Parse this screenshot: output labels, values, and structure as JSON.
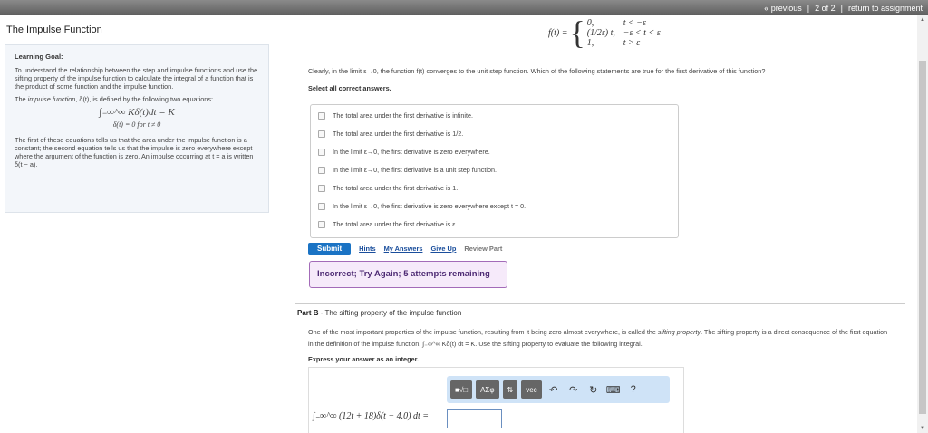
{
  "topbar": {
    "previous": "« previous",
    "position": "2 of 2",
    "return": "return to assignment"
  },
  "left": {
    "title": "The Impulse Function",
    "goal_heading": "Learning Goal:",
    "goal_text": "To understand the relationship between the step and impulse functions and use the sifting property of the impulse function to calculate the integral of a function that is the product of some function and the impulse function.",
    "def_pre": "The ",
    "def_em": "impulse function",
    "def_post": ", δ(t), is defined by the following two equations:",
    "eq1": "∫₋∞^∞ Kδ(t)dt = K",
    "eq2": "δ(t) = 0 for t ≠ 0",
    "explain": "The first of these equations tells us that the area under the impulse function is a constant; the second equation tells us that the impulse is zero everywhere except where the argument of the function is zero. An impulse occurring at t = a is written δ(t − a)."
  },
  "piecewise": {
    "lhs": "f(t) =",
    "rows": [
      [
        "0,",
        "t < −ε"
      ],
      [
        "(1/2ε) t,",
        "−ε < t < ε"
      ],
      [
        "1,",
        "t > ε"
      ]
    ]
  },
  "partA": {
    "question": "Clearly, in the limit ε→0, the function f(t) converges to the unit step function. Which of the following statements are true for the first derivative of this function?",
    "instruction": "Select all correct answers.",
    "options": [
      "The total area under the first derivative is infinite.",
      "The total area under the first derivative is 1/2.",
      "In the limit ε→0, the first derivative is zero everywhere.",
      "In the limit ε→0, the first derivative is a unit step function.",
      "The total area under the first derivative is 1.",
      "In the limit ε→0, the first derivative is zero everywhere except t = 0.",
      "The total area under the first derivative is ε."
    ],
    "submit": "Submit",
    "hints": "Hints",
    "my_answers": "My Answers",
    "give_up": "Give Up",
    "review": "Review Part",
    "feedback": "Incorrect; Try Again; 5 attempts remaining"
  },
  "partB": {
    "label": "Part B",
    "title": " - The sifting property of the impulse function",
    "desc_1": "One of the most important properties of the impulse function, resulting from it being zero almost everywhere, is called the ",
    "desc_em": "sifting property",
    "desc_2": ". The sifting property is a direct consequence of the first equation in the definition of the impulse function, ∫₋∞^∞ Kδ(t) dt = K. Use the sifting property to evaluate the following integral.",
    "express": "Express your answer as an integer.",
    "toolbar": {
      "templates": "■√□",
      "greek": "ΑΣφ",
      "arrows": "⇅",
      "vec": "vec",
      "undo": "↶",
      "redo": "↷",
      "reset": "↻",
      "keyboard": "⌨",
      "help": "?"
    },
    "integral": "∫₋∞^∞ (12t + 18)δ(t − 4.0) dt =",
    "answer_value": ""
  }
}
